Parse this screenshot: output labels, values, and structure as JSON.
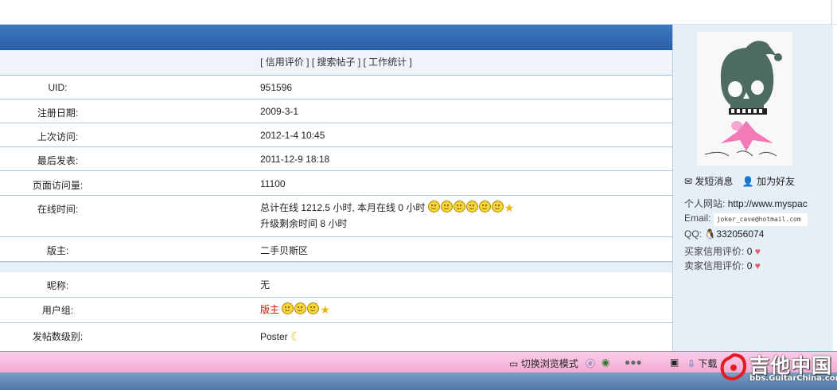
{
  "subnav": {
    "credit": "[ 信用评价 ]",
    "search_posts": "[ 搜索帖子 ]",
    "work_stats": "[ 工作统计 ]"
  },
  "profile_rows": [
    {
      "label": "UID:",
      "value": "951596"
    },
    {
      "label": "注册日期:",
      "value": "2009-3-1"
    },
    {
      "label": "上次访问:",
      "value": "2012-1-4 10:45"
    },
    {
      "label": "最后发表:",
      "value": "2011-12-9 18:18"
    },
    {
      "label": "页面访问量:",
      "value": "11100"
    },
    {
      "label": "在线时间:",
      "value": "总计在线 1212.5 小时, 本月在线 0 小时",
      "value2": "升级剩余时间 8 小时"
    },
    {
      "label": "版主:",
      "value": "二手贝斯区"
    }
  ],
  "extra_rows": [
    {
      "label": "昵称:",
      "value": "无"
    },
    {
      "label": "用户组:",
      "value": "版主"
    },
    {
      "label": "发帖数级别:",
      "value": "Poster"
    }
  ],
  "sidebar": {
    "send_message": "发短消息",
    "add_friend": "加为好友",
    "website_label": "个人网站:",
    "website_value": "http://www.myspac",
    "email_label": "Email:",
    "email_value": "joker_cave@hotmail.com",
    "qq_label": "QQ:",
    "qq_value": "332056074",
    "buyer_label": "买家信用评价:",
    "buyer_value": "0",
    "seller_label": "卖家信用评价:",
    "seller_value": "0"
  },
  "toolbar": {
    "switch_mode": "切换浏览模式",
    "download": "下载"
  },
  "watermark": {
    "title": "吉他中国",
    "url": "bbs.GuitarChina.com"
  },
  "colors": {
    "header": "#2f66ad",
    "toolbar": "#f3a8d2",
    "usergroup": "#cc1100"
  }
}
